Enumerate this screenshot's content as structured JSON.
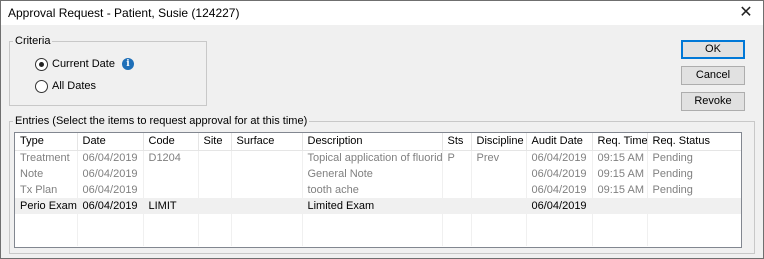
{
  "window": {
    "title": "Approval Request - Patient, Susie (124227)",
    "close_glyph": "✕"
  },
  "criteria": {
    "legend": "Criteria",
    "options": [
      {
        "label": "Current Date",
        "checked": true
      },
      {
        "label": "All Dates",
        "checked": false
      }
    ],
    "info_icon": "info-icon"
  },
  "buttons": {
    "ok": "OK",
    "cancel": "Cancel",
    "revoke": "Revoke"
  },
  "entries": {
    "legend": "Entries (Select the items to request approval for at this time)",
    "columns": [
      "Type",
      "Date",
      "Code",
      "Site",
      "Surface",
      "Description",
      "Sts",
      "Discipline",
      "Audit Date",
      "Req. Time",
      "Req. Status"
    ],
    "rows": [
      [
        "Treatment",
        "06/04/2019",
        "D1204",
        "",
        "",
        "Topical application of fluoride -",
        "P",
        "Prev",
        "06/04/2019",
        "09:15 AM",
        "Pending"
      ],
      [
        "Note",
        "06/04/2019",
        "",
        "",
        "",
        "General Note",
        "",
        "",
        "06/04/2019",
        "09:15 AM",
        "Pending"
      ],
      [
        "Tx Plan",
        "06/04/2019",
        "",
        "",
        "",
        "tooth ache",
        "",
        "",
        "06/04/2019",
        "09:15 AM",
        "Pending"
      ],
      [
        "Perio Exam",
        "06/04/2019",
        "LIMIT",
        "",
        "",
        "Limited Exam",
        "",
        "",
        "06/04/2019",
        "",
        ""
      ],
      [
        "",
        "",
        "",
        "",
        "",
        "",
        "",
        "",
        "",
        "",
        ""
      ],
      [
        "",
        "",
        "",
        "",
        "",
        "",
        "",
        "",
        "",
        "",
        ""
      ]
    ],
    "row_states": [
      "pending",
      "pending",
      "pending",
      "active",
      "empty",
      "empty"
    ]
  }
}
